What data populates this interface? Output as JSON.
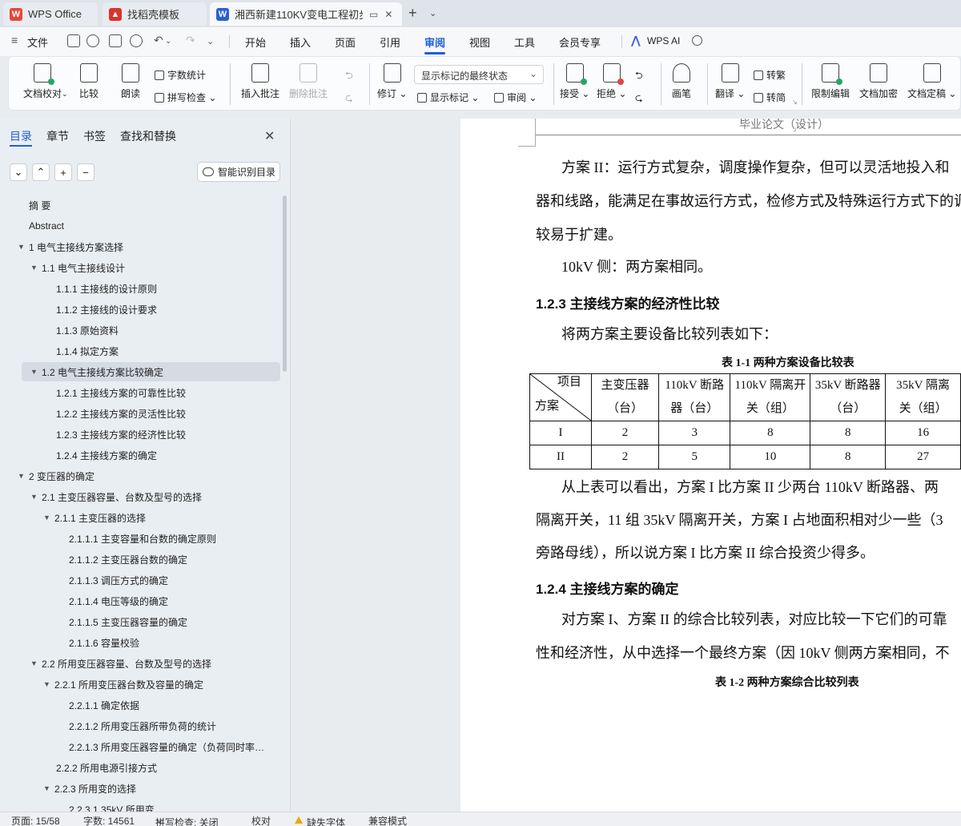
{
  "tabs": {
    "wps_office": "WPS Office",
    "template": "找稻壳模板",
    "document": "湘西新建110KV变电工程初步",
    "new_tab": "+"
  },
  "menu": {
    "file": "文件",
    "items": [
      "开始",
      "插入",
      "页面",
      "引用",
      "审阅",
      "视图",
      "工具",
      "会员专享"
    ],
    "active": "审阅",
    "wps_ai": "WPS AI"
  },
  "ribbon": {
    "doc_proof": "文档校对",
    "compare": "比较",
    "read_aloud": "朗读",
    "word_count": "字数统计",
    "spell_check": "拼写检查",
    "insert_comment": "插入批注",
    "delete_comment": "删除批注",
    "revise": "修订",
    "display_mode": "显示标记的最终状态",
    "show_markup": "显示标记",
    "review": "审阅",
    "accept": "接受",
    "reject": "拒绝",
    "pen": "画笔",
    "translate": "翻译",
    "to_traditional": "转繁",
    "to_simplified": "转简",
    "restrict_edit": "限制编辑",
    "encrypt": "文档加密",
    "finalize": "文档定稿"
  },
  "nav": {
    "tabs": [
      "目录",
      "章节",
      "书签",
      "查找和替换"
    ],
    "active_tab": "目录",
    "smart_toc": "智能识别目录",
    "toc": [
      {
        "level": 0,
        "text": "摘  要",
        "caret": ""
      },
      {
        "level": 0,
        "text": "Abstract",
        "caret": ""
      },
      {
        "level": 0,
        "text": "1  电气主接线方案选择",
        "caret": "▼"
      },
      {
        "level": 1,
        "text": "1.1  电气主接线设计",
        "caret": "▼"
      },
      {
        "level": 2,
        "text": "1.1.1  主接线的设计原则",
        "caret": ""
      },
      {
        "level": 2,
        "text": "1.1.2  主接线的设计要求",
        "caret": ""
      },
      {
        "level": 2,
        "text": "1.1.3  原始资料",
        "caret": ""
      },
      {
        "level": 2,
        "text": "1.1.4  拟定方案",
        "caret": ""
      },
      {
        "level": 1,
        "text": "1.2  电气主接线方案比较确定",
        "caret": "▼",
        "selected": true
      },
      {
        "level": 2,
        "text": "1.2.1  主接线方案的可靠性比较",
        "caret": ""
      },
      {
        "level": 2,
        "text": "1.2.2  主接线方案的灵活性比较",
        "caret": ""
      },
      {
        "level": 2,
        "text": "1.2.3  主接线方案的经济性比较",
        "caret": ""
      },
      {
        "level": 2,
        "text": "1.2.4  主接线方案的确定",
        "caret": ""
      },
      {
        "level": 0,
        "text": "2  变压器的确定",
        "caret": "▼"
      },
      {
        "level": 1,
        "text": "2.1  主变压器容量、台数及型号的选择",
        "caret": "▼"
      },
      {
        "level": 2,
        "text": "2.1.1  主变压器的选择",
        "caret": "▼"
      },
      {
        "level": 3,
        "text": "2.1.1.1  主变容量和台数的确定原则",
        "caret": ""
      },
      {
        "level": 3,
        "text": "2.1.1.2  主变压器台数的确定",
        "caret": ""
      },
      {
        "level": 3,
        "text": "2.1.1.3  调压方式的确定",
        "caret": ""
      },
      {
        "level": 3,
        "text": "2.1.1.4  电压等级的确定",
        "caret": ""
      },
      {
        "level": 3,
        "text": "2.1.1.5  主变压器容量的确定",
        "caret": ""
      },
      {
        "level": 3,
        "text": "2.1.1.6  容量校验",
        "caret": ""
      },
      {
        "level": 1,
        "text": "2.2  所用变压器容量、台数及型号的选择",
        "caret": "▼"
      },
      {
        "level": 2,
        "text": "2.2.1  所用变压器台数及容量的确定",
        "caret": "▼"
      },
      {
        "level": 3,
        "text": "2.2.1.1  确定依据",
        "caret": ""
      },
      {
        "level": 3,
        "text": "2.2.1.2  所用变压器所带负荷的统计",
        "caret": ""
      },
      {
        "level": 3,
        "text": "2.2.1.3  所用变压器容量的确定（负荷同时率…",
        "caret": ""
      },
      {
        "level": 2,
        "text": "2.2.2  所用电源引接方式",
        "caret": ""
      },
      {
        "level": 2,
        "text": "2.2.3  所用变的选择",
        "caret": "▼"
      },
      {
        "level": 3,
        "text": "2.2.3.1  35kV 所用变",
        "caret": ""
      }
    ]
  },
  "document": {
    "header": "毕业论文（设计）",
    "para1_l1": "方案 II：运行方式复杂，调度操作复杂，但可以灵活地投入和",
    "para1_l2": "器和线路，能满足在事故运行方式，检修方式及特殊运行方式下的调",
    "para1_l3": "较易于扩建。",
    "para2": "10kV 侧：两方案相同。",
    "h_123": "1.2.3  主接线方案的经济性比较",
    "para3": "将两方案主要设备比较列表如下：",
    "table1_caption": "表 1-1  两种方案设备比较表",
    "table1": {
      "corner_top": "项目",
      "corner_bottom": "方案",
      "headers": [
        [
          "主变压器",
          "（台）"
        ],
        [
          "110kV 断路",
          "器（台）"
        ],
        [
          "110kV 隔离开",
          "关（组）"
        ],
        [
          "35kV 断路器",
          "（台）"
        ],
        [
          "35kV 隔离",
          "关（组）"
        ]
      ],
      "rows": [
        [
          "I",
          "2",
          "3",
          "8",
          "8",
          "16"
        ],
        [
          "II",
          "2",
          "5",
          "10",
          "8",
          "27"
        ]
      ]
    },
    "para4_l1": "从上表可以看出，方案 I 比方案 II 少两台 110kV 断路器、两",
    "para4_l2": "隔离开关，11 组 35kV 隔离开关，方案 I 占地面积相对少一些（3",
    "para4_l3": "旁路母线），所以说方案 I  比方案 II 综合投资少得多。",
    "h_124": "1.2.4  主接线方案的确定",
    "para5_l1": "对方案 I、方案 II 的综合比较列表，对应比较一下它们的可靠",
    "para5_l2": "性和经济性，从中选择一个最终方案（因 10kV 侧两方案相同，不",
    "table2_caption": "表 1-2  两种方案综合比较列表"
  },
  "status": {
    "page": "页面: 15/58",
    "words": "字数: 14561",
    "spell": "拼写检查: 关闭",
    "proof": "校对",
    "missing_font": "缺失字体",
    "compat": "兼容模式"
  },
  "colors": {
    "accent": "#1f5fd6",
    "wps_red": "#e6473b",
    "template_red": "#d9342b",
    "doc_blue": "#2a5fd8"
  }
}
